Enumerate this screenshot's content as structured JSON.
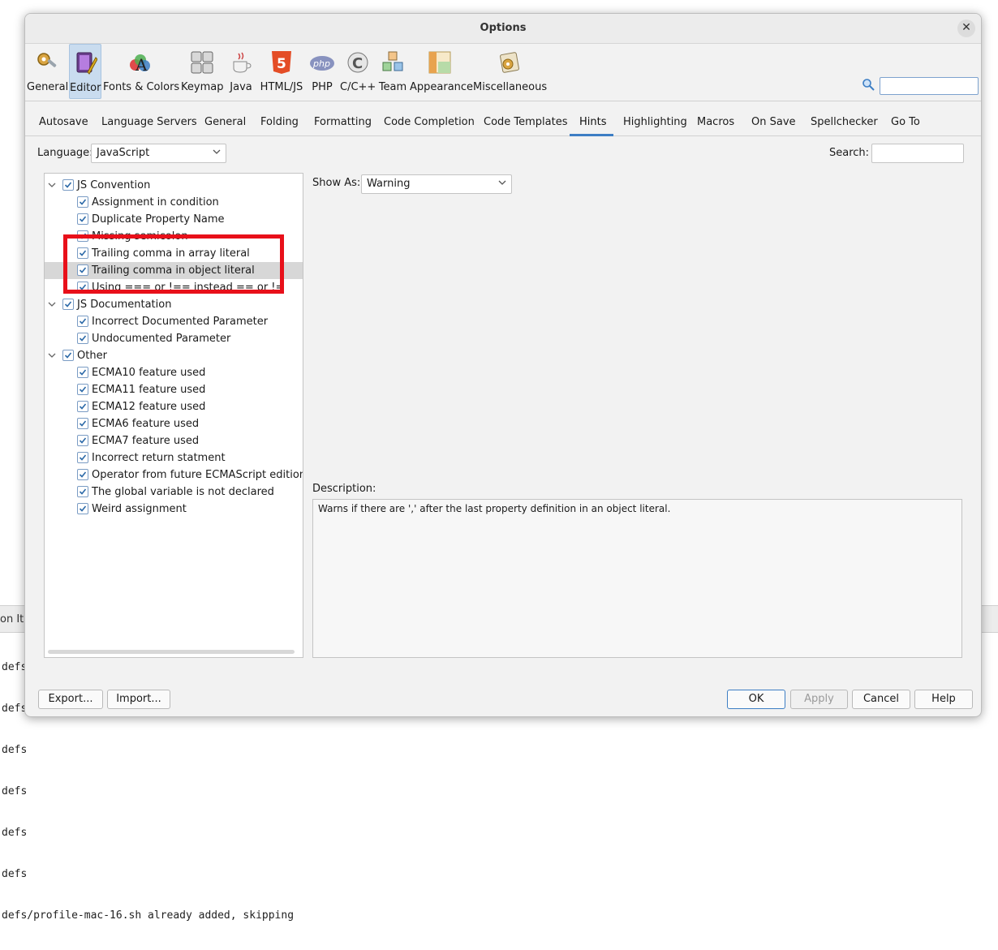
{
  "terminal": {
    "header": "on Ite",
    "lines": [
      "defs",
      "defs",
      "defs",
      "defs",
      "defs",
      "defs",
      "defs/profile-mac-16.sh already added, skipping"
    ]
  },
  "dialog": {
    "title": "Options",
    "categories": [
      "General",
      "Editor",
      "Fonts & Colors",
      "Keymap",
      "Java",
      "HTML/JS",
      "PHP",
      "C/C++",
      "Team",
      "Appearance",
      "Miscellaneous"
    ],
    "selected_category": "Editor",
    "tabs": [
      "Autosave",
      "Language Servers",
      "General",
      "Folding",
      "Formatting",
      "Code Completion",
      "Code Templates",
      "Hints",
      "Highlighting",
      "Macros",
      "On Save",
      "Spellchecker",
      "Go To"
    ],
    "active_tab": "Hints",
    "language_label": "Language:",
    "language_value": "JavaScript",
    "search_label": "Search:",
    "tree": [
      {
        "label": "JS Convention",
        "group": true
      },
      {
        "label": "Assignment in condition"
      },
      {
        "label": "Duplicate Property Name"
      },
      {
        "label": "Missing semicolon"
      },
      {
        "label": "Trailing comma in array literal"
      },
      {
        "label": "Trailing comma in object literal",
        "selected": true
      },
      {
        "label": "Using === or !== instead == or !="
      },
      {
        "label": "JS Documentation",
        "group": true
      },
      {
        "label": "Incorrect Documented Parameter"
      },
      {
        "label": "Undocumented Parameter"
      },
      {
        "label": "Other",
        "group": true
      },
      {
        "label": "ECMA10 feature used"
      },
      {
        "label": "ECMA11 feature used"
      },
      {
        "label": "ECMA12 feature used"
      },
      {
        "label": "ECMA6 feature used"
      },
      {
        "label": "ECMA7 feature used"
      },
      {
        "label": "Incorrect return statment"
      },
      {
        "label": "Operator from future ECMAScript edition used"
      },
      {
        "label": "The global variable is not declared"
      },
      {
        "label": "Weird assignment"
      }
    ],
    "show_as_label": "Show As:",
    "show_as_value": "Warning",
    "description_label": "Description:",
    "description_text": "Warns if there are ',' after the last property definition in an object literal.",
    "buttons": {
      "export": "Export...",
      "import": "Import...",
      "ok": "OK",
      "apply": "Apply",
      "cancel": "Cancel",
      "help": "Help"
    },
    "colors": {
      "highlight": "#e8101a",
      "accent": "#3d7ec4",
      "selected_category_bg": "#c9dcef"
    }
  }
}
